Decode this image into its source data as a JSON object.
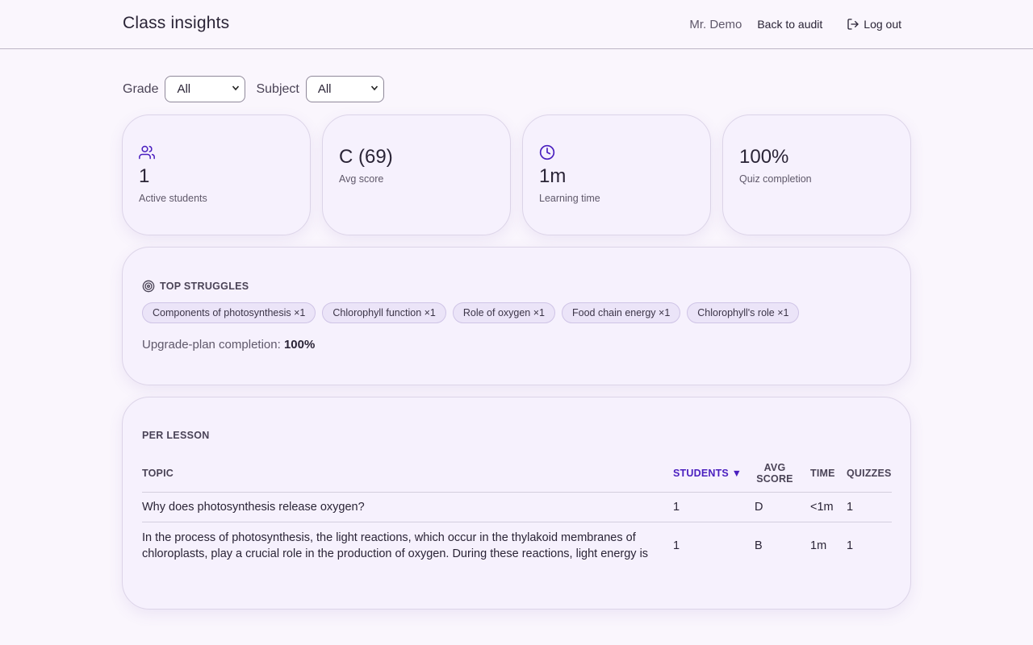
{
  "header": {
    "title": "Class insights",
    "user": "Mr. Demo",
    "back_link": "Back to audit",
    "logout": "Log out"
  },
  "filters": {
    "grade_label": "Grade",
    "grade_value": "All",
    "subject_label": "Subject",
    "subject_value": "All"
  },
  "stats": [
    {
      "icon": "users-icon",
      "value": "1",
      "label": "Active students"
    },
    {
      "icon": "",
      "value": "C (69)",
      "label": "Avg score"
    },
    {
      "icon": "clock-icon",
      "value": "1m",
      "label": "Learning time"
    },
    {
      "icon": "",
      "value": "100%",
      "label": "Quiz completion"
    }
  ],
  "struggles": {
    "heading": "TOP STRUGGLES",
    "chips": [
      "Components of photosynthesis ×1",
      "Chlorophyll function ×1",
      "Role of oxygen ×1",
      "Food chain energy ×1",
      "Chlorophyll's role ×1"
    ],
    "upgrade_label": "Upgrade-plan completion:",
    "upgrade_value": "100%"
  },
  "lessons": {
    "heading": "PER LESSON",
    "columns": {
      "topic": "TOPIC",
      "students": "STUDENTS",
      "sort_indicator": "▼",
      "avg_score_1": "AVG",
      "avg_score_2": "SCORE",
      "time": "TIME",
      "quizzes": "QUIZZES"
    },
    "rows": [
      {
        "topic": "Why does photosynthesis release oxygen?",
        "students": "1",
        "avg_score": "D",
        "time": "<1m",
        "quizzes": "1"
      },
      {
        "topic": "In the process of photosynthesis, the light reactions, which occur in the thylakoid membranes of chloroplasts, play a crucial role in the production of oxygen. During these reactions, light energy is",
        "students": "1",
        "avg_score": "B",
        "time": "1m",
        "quizzes": "1"
      }
    ]
  },
  "colors": {
    "accent": "#4a1fbf",
    "background": "#faf6fd",
    "card": "#f6f1fd",
    "chip": "#ebe4f8"
  }
}
